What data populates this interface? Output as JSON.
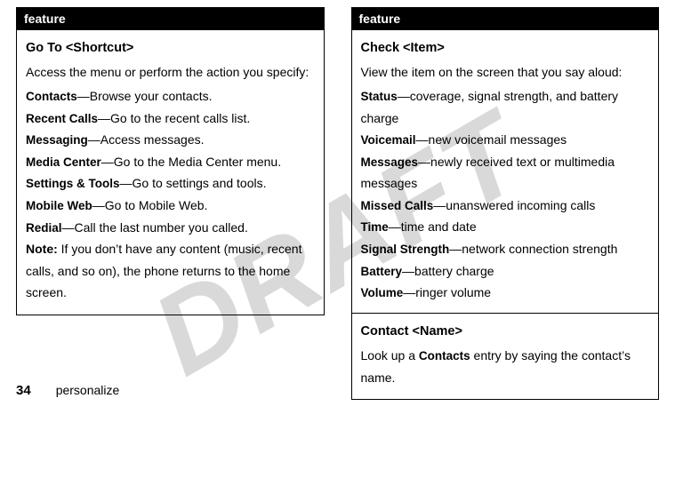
{
  "watermark": "DRAFT",
  "left": {
    "header": "feature",
    "cells": [
      {
        "title": "Go To <Shortcut>",
        "desc": "Access the menu or perform the action you specify:",
        "items": [
          {
            "term": "Contacts",
            "def": "Browse your contacts."
          },
          {
            "term": "Recent Calls",
            "def": "Go to the recent calls list."
          },
          {
            "term": "Messaging",
            "def": "Access messages."
          },
          {
            "term": "Media Center",
            "def": "Go to the Media Center menu."
          },
          {
            "term": "Settings & Tools",
            "def": "Go to settings and tools."
          },
          {
            "term": "Mobile Web",
            "def": "Go to Mobile Web."
          },
          {
            "term": "Redial",
            "def": "Call the last number you called."
          }
        ],
        "note_label": "Note:",
        "note_text": " If you don’t have any content (music, recent calls, and so on), the phone returns to the home screen."
      }
    ]
  },
  "right": {
    "header": "feature",
    "cells": [
      {
        "title": "Check <Item>",
        "desc": "View the item on the screen that you say aloud:",
        "items": [
          {
            "term": "Status",
            "def": "coverage, signal strength, and battery charge"
          },
          {
            "term": "Voicemail",
            "def": "new voicemail messages"
          },
          {
            "term": "Messages",
            "def": "newly received text or multimedia messages"
          },
          {
            "term": "Missed Calls",
            "def": "unanswered incoming calls"
          },
          {
            "term": "Time",
            "def": "time and date"
          },
          {
            "term": "Signal Strength",
            "def": "network connection strength"
          },
          {
            "term": "Battery",
            "def": "battery charge"
          },
          {
            "term": "Volume",
            "def": "ringer volume"
          }
        ]
      },
      {
        "title": "Contact <Name>",
        "desc_parts": {
          "pre": "Look up a ",
          "term": "Contacts",
          "post": " entry by saying the contact’s name."
        }
      }
    ]
  },
  "footer": {
    "page": "34",
    "section": "personalize"
  }
}
